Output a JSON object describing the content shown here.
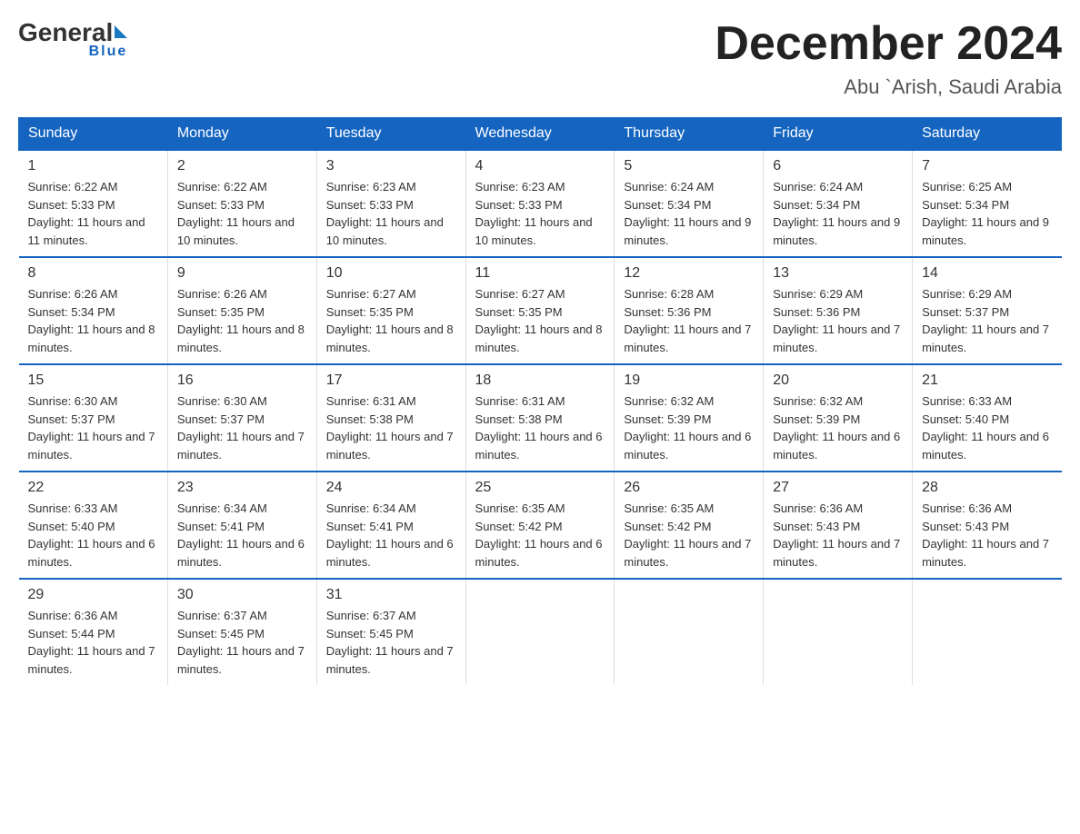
{
  "header": {
    "logo": {
      "general": "General",
      "blue": "Blue"
    },
    "title": "December 2024",
    "location": "Abu `Arish, Saudi Arabia"
  },
  "weekdays": [
    "Sunday",
    "Monday",
    "Tuesday",
    "Wednesday",
    "Thursday",
    "Friday",
    "Saturday"
  ],
  "weeks": [
    [
      {
        "day": "1",
        "sunrise": "6:22 AM",
        "sunset": "5:33 PM",
        "daylight": "11 hours and 11 minutes."
      },
      {
        "day": "2",
        "sunrise": "6:22 AM",
        "sunset": "5:33 PM",
        "daylight": "11 hours and 10 minutes."
      },
      {
        "day": "3",
        "sunrise": "6:23 AM",
        "sunset": "5:33 PM",
        "daylight": "11 hours and 10 minutes."
      },
      {
        "day": "4",
        "sunrise": "6:23 AM",
        "sunset": "5:33 PM",
        "daylight": "11 hours and 10 minutes."
      },
      {
        "day": "5",
        "sunrise": "6:24 AM",
        "sunset": "5:34 PM",
        "daylight": "11 hours and 9 minutes."
      },
      {
        "day": "6",
        "sunrise": "6:24 AM",
        "sunset": "5:34 PM",
        "daylight": "11 hours and 9 minutes."
      },
      {
        "day": "7",
        "sunrise": "6:25 AM",
        "sunset": "5:34 PM",
        "daylight": "11 hours and 9 minutes."
      }
    ],
    [
      {
        "day": "8",
        "sunrise": "6:26 AM",
        "sunset": "5:34 PM",
        "daylight": "11 hours and 8 minutes."
      },
      {
        "day": "9",
        "sunrise": "6:26 AM",
        "sunset": "5:35 PM",
        "daylight": "11 hours and 8 minutes."
      },
      {
        "day": "10",
        "sunrise": "6:27 AM",
        "sunset": "5:35 PM",
        "daylight": "11 hours and 8 minutes."
      },
      {
        "day": "11",
        "sunrise": "6:27 AM",
        "sunset": "5:35 PM",
        "daylight": "11 hours and 8 minutes."
      },
      {
        "day": "12",
        "sunrise": "6:28 AM",
        "sunset": "5:36 PM",
        "daylight": "11 hours and 7 minutes."
      },
      {
        "day": "13",
        "sunrise": "6:29 AM",
        "sunset": "5:36 PM",
        "daylight": "11 hours and 7 minutes."
      },
      {
        "day": "14",
        "sunrise": "6:29 AM",
        "sunset": "5:37 PM",
        "daylight": "11 hours and 7 minutes."
      }
    ],
    [
      {
        "day": "15",
        "sunrise": "6:30 AM",
        "sunset": "5:37 PM",
        "daylight": "11 hours and 7 minutes."
      },
      {
        "day": "16",
        "sunrise": "6:30 AM",
        "sunset": "5:37 PM",
        "daylight": "11 hours and 7 minutes."
      },
      {
        "day": "17",
        "sunrise": "6:31 AM",
        "sunset": "5:38 PM",
        "daylight": "11 hours and 7 minutes."
      },
      {
        "day": "18",
        "sunrise": "6:31 AM",
        "sunset": "5:38 PM",
        "daylight": "11 hours and 6 minutes."
      },
      {
        "day": "19",
        "sunrise": "6:32 AM",
        "sunset": "5:39 PM",
        "daylight": "11 hours and 6 minutes."
      },
      {
        "day": "20",
        "sunrise": "6:32 AM",
        "sunset": "5:39 PM",
        "daylight": "11 hours and 6 minutes."
      },
      {
        "day": "21",
        "sunrise": "6:33 AM",
        "sunset": "5:40 PM",
        "daylight": "11 hours and 6 minutes."
      }
    ],
    [
      {
        "day": "22",
        "sunrise": "6:33 AM",
        "sunset": "5:40 PM",
        "daylight": "11 hours and 6 minutes."
      },
      {
        "day": "23",
        "sunrise": "6:34 AM",
        "sunset": "5:41 PM",
        "daylight": "11 hours and 6 minutes."
      },
      {
        "day": "24",
        "sunrise": "6:34 AM",
        "sunset": "5:41 PM",
        "daylight": "11 hours and 6 minutes."
      },
      {
        "day": "25",
        "sunrise": "6:35 AM",
        "sunset": "5:42 PM",
        "daylight": "11 hours and 6 minutes."
      },
      {
        "day": "26",
        "sunrise": "6:35 AM",
        "sunset": "5:42 PM",
        "daylight": "11 hours and 7 minutes."
      },
      {
        "day": "27",
        "sunrise": "6:36 AM",
        "sunset": "5:43 PM",
        "daylight": "11 hours and 7 minutes."
      },
      {
        "day": "28",
        "sunrise": "6:36 AM",
        "sunset": "5:43 PM",
        "daylight": "11 hours and 7 minutes."
      }
    ],
    [
      {
        "day": "29",
        "sunrise": "6:36 AM",
        "sunset": "5:44 PM",
        "daylight": "11 hours and 7 minutes."
      },
      {
        "day": "30",
        "sunrise": "6:37 AM",
        "sunset": "5:45 PM",
        "daylight": "11 hours and 7 minutes."
      },
      {
        "day": "31",
        "sunrise": "6:37 AM",
        "sunset": "5:45 PM",
        "daylight": "11 hours and 7 minutes."
      },
      null,
      null,
      null,
      null
    ]
  ],
  "labels": {
    "sunrise": "Sunrise:",
    "sunset": "Sunset:",
    "daylight": "Daylight:"
  }
}
